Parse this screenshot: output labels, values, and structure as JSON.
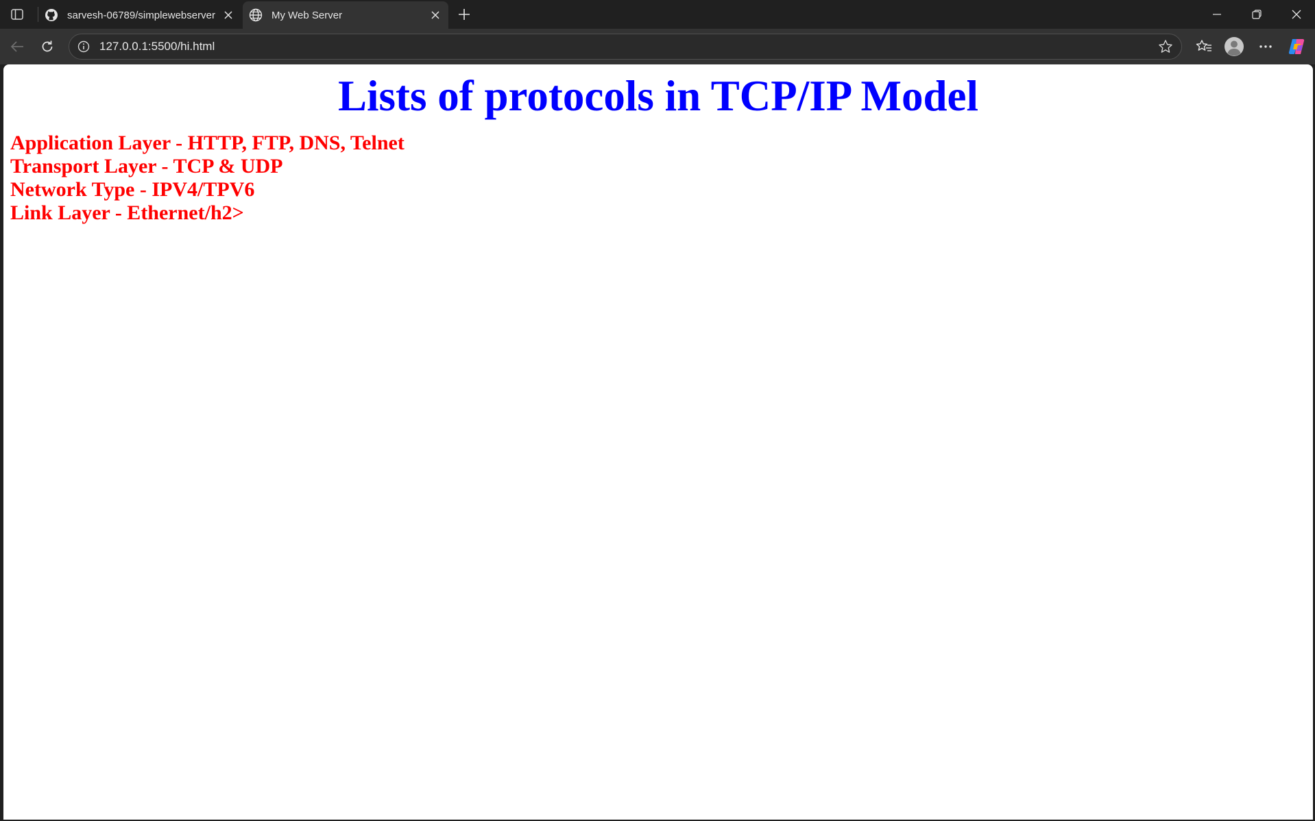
{
  "tabs": [
    {
      "title": "sarvesh-06789/simplewebserver",
      "favicon": "github-icon",
      "active": false
    },
    {
      "title": "My Web Server",
      "favicon": "globe-icon",
      "active": true
    }
  ],
  "toolbar": {
    "url": "127.0.0.1:5500/hi.html"
  },
  "page": {
    "title": "Lists of protocols in TCP/IP Model",
    "layers": [
      "Application Layer - HTTP, FTP, DNS, Telnet",
      "Transport Layer - TCP & UDP",
      "Network Type - IPV4/TPV6",
      "Link Layer - Ethernet/h2>"
    ]
  },
  "colors": {
    "title": "#0000ff",
    "layers": "#ff0000",
    "chrome_dark": "#202020",
    "toolbar": "#333333"
  },
  "icons": [
    "sidebar-icon",
    "github-icon",
    "close-icon",
    "globe-icon",
    "new-tab-icon",
    "minimize-icon",
    "restore-icon",
    "window-close-icon",
    "back-icon",
    "refresh-icon",
    "info-icon",
    "star-icon",
    "favorites-icon",
    "profile-icon",
    "more-icon",
    "copilot-icon"
  ]
}
